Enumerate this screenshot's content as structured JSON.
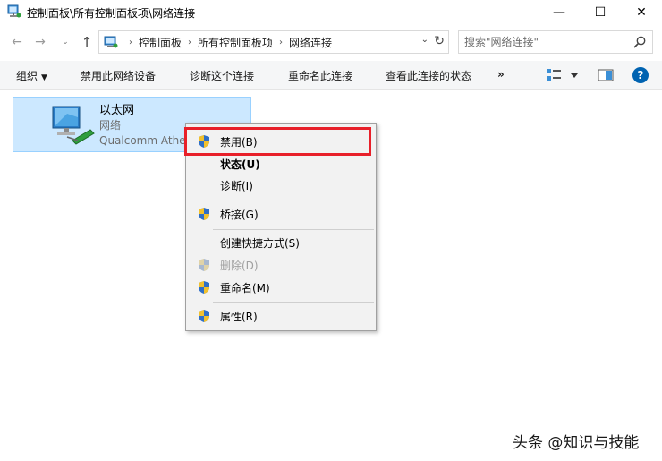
{
  "window": {
    "title": "控制面板\\所有控制面板项\\网络连接",
    "minimize_glyph": "—",
    "maximize_glyph": "☐",
    "close_glyph": "✕"
  },
  "nav": {
    "back_glyph": "←",
    "forward_glyph": "→",
    "history_glyph": "⌄",
    "up_glyph": "↑"
  },
  "address": {
    "breadcrumbs": [
      "控制面板",
      "所有控制面板项",
      "网络连接"
    ],
    "separator_glyph": "›",
    "dropdown_glyph": "⌄",
    "refresh_glyph": "↻"
  },
  "search": {
    "placeholder": "搜索\"网络连接\""
  },
  "toolbar": {
    "organize_label": "组织",
    "organize_caret": "▼",
    "disable_label": "禁用此网络设备",
    "diagnose_label": "诊断这个连接",
    "rename_label": "重命名此连接",
    "status_label": "查看此连接的状态",
    "more_label": "»",
    "help_label": "?"
  },
  "connection": {
    "name": "以太网",
    "network": "网络",
    "device": "Qualcomm Atheros"
  },
  "context_menu": {
    "items": [
      {
        "label": "禁用(B)",
        "icon": "shield-icon"
      },
      {
        "label": "状态(U)"
      },
      {
        "label": "诊断(I)"
      },
      {
        "label": "桥接(G)",
        "icon": "shield-icon"
      },
      {
        "label": "创建快捷方式(S)"
      },
      {
        "label": "删除(D)",
        "icon": "shield-icon",
        "disabled": true
      },
      {
        "label": "重命名(M)",
        "icon": "shield-icon"
      },
      {
        "label": "属性(R)",
        "icon": "shield-icon"
      }
    ],
    "highlight_color": "#e8202a"
  },
  "watermark": "头条 @知识与技能",
  "colors": {
    "selection_bg": "#cce8ff",
    "selection_border": "#99d1ff",
    "menu_bg": "#f2f2f2",
    "help_blue": "#0063b1"
  }
}
